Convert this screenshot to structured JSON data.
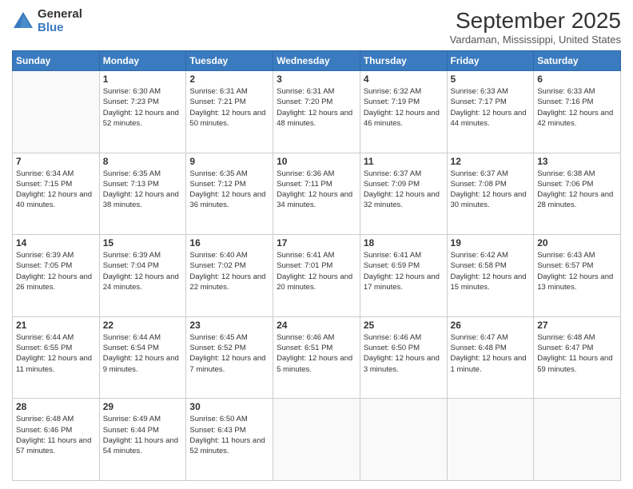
{
  "logo": {
    "general": "General",
    "blue": "Blue"
  },
  "header": {
    "month": "September 2025",
    "location": "Vardaman, Mississippi, United States"
  },
  "weekdays": [
    "Sunday",
    "Monday",
    "Tuesday",
    "Wednesday",
    "Thursday",
    "Friday",
    "Saturday"
  ],
  "weeks": [
    [
      {
        "day": "",
        "sunrise": "",
        "sunset": "",
        "daylight": ""
      },
      {
        "day": "1",
        "sunrise": "Sunrise: 6:30 AM",
        "sunset": "Sunset: 7:23 PM",
        "daylight": "Daylight: 12 hours and 52 minutes."
      },
      {
        "day": "2",
        "sunrise": "Sunrise: 6:31 AM",
        "sunset": "Sunset: 7:21 PM",
        "daylight": "Daylight: 12 hours and 50 minutes."
      },
      {
        "day": "3",
        "sunrise": "Sunrise: 6:31 AM",
        "sunset": "Sunset: 7:20 PM",
        "daylight": "Daylight: 12 hours and 48 minutes."
      },
      {
        "day": "4",
        "sunrise": "Sunrise: 6:32 AM",
        "sunset": "Sunset: 7:19 PM",
        "daylight": "Daylight: 12 hours and 46 minutes."
      },
      {
        "day": "5",
        "sunrise": "Sunrise: 6:33 AM",
        "sunset": "Sunset: 7:17 PM",
        "daylight": "Daylight: 12 hours and 44 minutes."
      },
      {
        "day": "6",
        "sunrise": "Sunrise: 6:33 AM",
        "sunset": "Sunset: 7:16 PM",
        "daylight": "Daylight: 12 hours and 42 minutes."
      }
    ],
    [
      {
        "day": "7",
        "sunrise": "Sunrise: 6:34 AM",
        "sunset": "Sunset: 7:15 PM",
        "daylight": "Daylight: 12 hours and 40 minutes."
      },
      {
        "day": "8",
        "sunrise": "Sunrise: 6:35 AM",
        "sunset": "Sunset: 7:13 PM",
        "daylight": "Daylight: 12 hours and 38 minutes."
      },
      {
        "day": "9",
        "sunrise": "Sunrise: 6:35 AM",
        "sunset": "Sunset: 7:12 PM",
        "daylight": "Daylight: 12 hours and 36 minutes."
      },
      {
        "day": "10",
        "sunrise": "Sunrise: 6:36 AM",
        "sunset": "Sunset: 7:11 PM",
        "daylight": "Daylight: 12 hours and 34 minutes."
      },
      {
        "day": "11",
        "sunrise": "Sunrise: 6:37 AM",
        "sunset": "Sunset: 7:09 PM",
        "daylight": "Daylight: 12 hours and 32 minutes."
      },
      {
        "day": "12",
        "sunrise": "Sunrise: 6:37 AM",
        "sunset": "Sunset: 7:08 PM",
        "daylight": "Daylight: 12 hours and 30 minutes."
      },
      {
        "day": "13",
        "sunrise": "Sunrise: 6:38 AM",
        "sunset": "Sunset: 7:06 PM",
        "daylight": "Daylight: 12 hours and 28 minutes."
      }
    ],
    [
      {
        "day": "14",
        "sunrise": "Sunrise: 6:39 AM",
        "sunset": "Sunset: 7:05 PM",
        "daylight": "Daylight: 12 hours and 26 minutes."
      },
      {
        "day": "15",
        "sunrise": "Sunrise: 6:39 AM",
        "sunset": "Sunset: 7:04 PM",
        "daylight": "Daylight: 12 hours and 24 minutes."
      },
      {
        "day": "16",
        "sunrise": "Sunrise: 6:40 AM",
        "sunset": "Sunset: 7:02 PM",
        "daylight": "Daylight: 12 hours and 22 minutes."
      },
      {
        "day": "17",
        "sunrise": "Sunrise: 6:41 AM",
        "sunset": "Sunset: 7:01 PM",
        "daylight": "Daylight: 12 hours and 20 minutes."
      },
      {
        "day": "18",
        "sunrise": "Sunrise: 6:41 AM",
        "sunset": "Sunset: 6:59 PM",
        "daylight": "Daylight: 12 hours and 17 minutes."
      },
      {
        "day": "19",
        "sunrise": "Sunrise: 6:42 AM",
        "sunset": "Sunset: 6:58 PM",
        "daylight": "Daylight: 12 hours and 15 minutes."
      },
      {
        "day": "20",
        "sunrise": "Sunrise: 6:43 AM",
        "sunset": "Sunset: 6:57 PM",
        "daylight": "Daylight: 12 hours and 13 minutes."
      }
    ],
    [
      {
        "day": "21",
        "sunrise": "Sunrise: 6:44 AM",
        "sunset": "Sunset: 6:55 PM",
        "daylight": "Daylight: 12 hours and 11 minutes."
      },
      {
        "day": "22",
        "sunrise": "Sunrise: 6:44 AM",
        "sunset": "Sunset: 6:54 PM",
        "daylight": "Daylight: 12 hours and 9 minutes."
      },
      {
        "day": "23",
        "sunrise": "Sunrise: 6:45 AM",
        "sunset": "Sunset: 6:52 PM",
        "daylight": "Daylight: 12 hours and 7 minutes."
      },
      {
        "day": "24",
        "sunrise": "Sunrise: 6:46 AM",
        "sunset": "Sunset: 6:51 PM",
        "daylight": "Daylight: 12 hours and 5 minutes."
      },
      {
        "day": "25",
        "sunrise": "Sunrise: 6:46 AM",
        "sunset": "Sunset: 6:50 PM",
        "daylight": "Daylight: 12 hours and 3 minutes."
      },
      {
        "day": "26",
        "sunrise": "Sunrise: 6:47 AM",
        "sunset": "Sunset: 6:48 PM",
        "daylight": "Daylight: 12 hours and 1 minute."
      },
      {
        "day": "27",
        "sunrise": "Sunrise: 6:48 AM",
        "sunset": "Sunset: 6:47 PM",
        "daylight": "Daylight: 11 hours and 59 minutes."
      }
    ],
    [
      {
        "day": "28",
        "sunrise": "Sunrise: 6:48 AM",
        "sunset": "Sunset: 6:46 PM",
        "daylight": "Daylight: 11 hours and 57 minutes."
      },
      {
        "day": "29",
        "sunrise": "Sunrise: 6:49 AM",
        "sunset": "Sunset: 6:44 PM",
        "daylight": "Daylight: 11 hours and 54 minutes."
      },
      {
        "day": "30",
        "sunrise": "Sunrise: 6:50 AM",
        "sunset": "Sunset: 6:43 PM",
        "daylight": "Daylight: 11 hours and 52 minutes."
      },
      {
        "day": "",
        "sunrise": "",
        "sunset": "",
        "daylight": ""
      },
      {
        "day": "",
        "sunrise": "",
        "sunset": "",
        "daylight": ""
      },
      {
        "day": "",
        "sunrise": "",
        "sunset": "",
        "daylight": ""
      },
      {
        "day": "",
        "sunrise": "",
        "sunset": "",
        "daylight": ""
      }
    ]
  ]
}
